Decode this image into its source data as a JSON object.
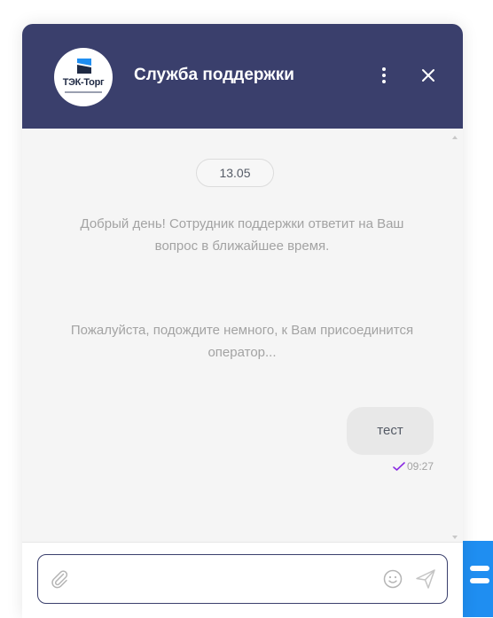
{
  "header": {
    "logo_text": "ТЭК-Торг",
    "title": "Служба поддержки",
    "menu_icon": "more-vertical-icon",
    "close_icon": "close-icon"
  },
  "chat": {
    "date": "13.05",
    "system_messages": [
      "Добрый день! Сотрудник поддержки ответит на Ваш вопрос в ближайшее время.",
      "Пожалуйста, подождите немного, к Вам присоединится оператор..."
    ],
    "user_message": {
      "text": "тест",
      "time": "09:27",
      "status_icon": "check-icon"
    }
  },
  "composer": {
    "input_value": "",
    "input_placeholder": "",
    "attach_icon": "paperclip-icon",
    "emoji_icon": "smile-icon",
    "send_icon": "send-icon"
  },
  "colors": {
    "header_bg": "#3a3f6c",
    "chat_bg": "#f5f5f5",
    "check_accent": "#8a2be2",
    "launcher": "#1f8ef1"
  }
}
